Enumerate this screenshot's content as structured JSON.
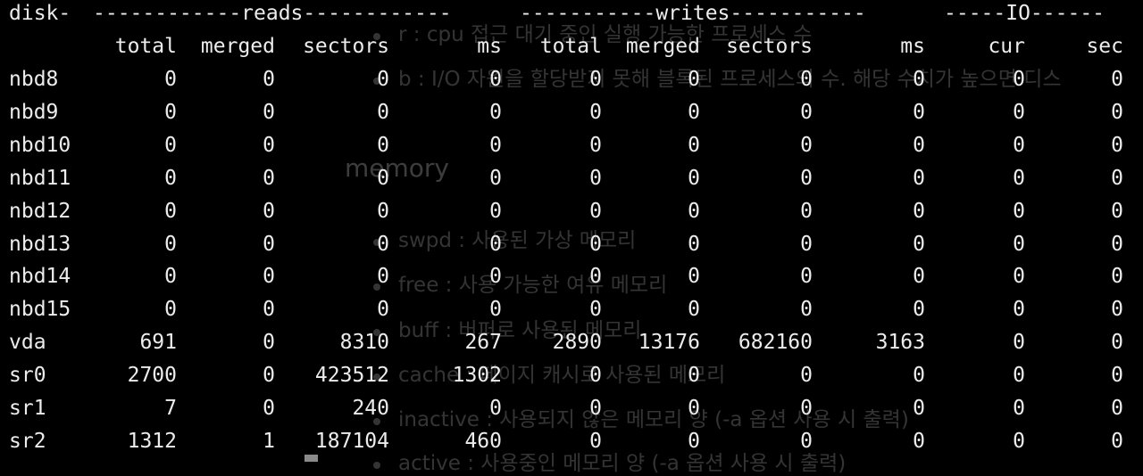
{
  "terminal": {
    "group_header": {
      "disk": "disk-",
      "reads": "------------reads------------",
      "writes": "-----------writes-----------",
      "io": "-----IO------"
    },
    "columns": [
      "total",
      "merged",
      "sectors",
      "ms",
      "total",
      "merged",
      "sectors",
      "ms",
      "cur",
      "sec"
    ],
    "rows": [
      {
        "name": "nbd8",
        "values": [
          "0",
          "0",
          "0",
          "0",
          "0",
          "0",
          "0",
          "0",
          "0",
          "0"
        ]
      },
      {
        "name": "nbd9",
        "values": [
          "0",
          "0",
          "0",
          "0",
          "0",
          "0",
          "0",
          "0",
          "0",
          "0"
        ]
      },
      {
        "name": "nbd10",
        "values": [
          "0",
          "0",
          "0",
          "0",
          "0",
          "0",
          "0",
          "0",
          "0",
          "0"
        ]
      },
      {
        "name": "nbd11",
        "values": [
          "0",
          "0",
          "0",
          "0",
          "0",
          "0",
          "0",
          "0",
          "0",
          "0"
        ]
      },
      {
        "name": "nbd12",
        "values": [
          "0",
          "0",
          "0",
          "0",
          "0",
          "0",
          "0",
          "0",
          "0",
          "0"
        ]
      },
      {
        "name": "nbd13",
        "values": [
          "0",
          "0",
          "0",
          "0",
          "0",
          "0",
          "0",
          "0",
          "0",
          "0"
        ]
      },
      {
        "name": "nbd14",
        "values": [
          "0",
          "0",
          "0",
          "0",
          "0",
          "0",
          "0",
          "0",
          "0",
          "0"
        ]
      },
      {
        "name": "nbd15",
        "values": [
          "0",
          "0",
          "0",
          "0",
          "0",
          "0",
          "0",
          "0",
          "0",
          "0"
        ]
      },
      {
        "name": "vda",
        "values": [
          "691",
          "0",
          "8310",
          "267",
          "2890",
          "13176",
          "682160",
          "3163",
          "0",
          "0"
        ]
      },
      {
        "name": "sr0",
        "values": [
          "2700",
          "0",
          "423512",
          "1302",
          "0",
          "0",
          "0",
          "0",
          "0",
          "0"
        ]
      },
      {
        "name": "sr1",
        "values": [
          "7",
          "0",
          "240",
          "0",
          "0",
          "0",
          "0",
          "0",
          "0",
          "0"
        ]
      },
      {
        "name": "sr2",
        "values": [
          "1312",
          "1",
          "187104",
          "460",
          "0",
          "0",
          "0",
          "0",
          "0",
          "0"
        ]
      }
    ]
  },
  "background_page": {
    "items_top": [
      "r : cpu 접근 대기 중인 실행 가능한 프로세스 수",
      "b : I/O 자원을 할당받지 못해 블록된 프로세스의 수. 해당 수치가 높으면 디스"
    ],
    "heading": "memory",
    "items_memory": [
      "swpd : 사용된 가상 메모리",
      "free : 사용 가능한 여유 메모리",
      "buff : 버퍼로 사용된 메모리",
      "cache : 페이지 캐시로 사용된 메모리",
      "inactive : 사용되지 않은 메모리 양 (-a 옵션 사용 시 출력)",
      "active : 사용중인 메모리 양 (-a 옵션 사용 시 출력)"
    ]
  },
  "colors": {
    "background": "#000000",
    "foreground": "#ececec",
    "cursor": "#8a8a8a"
  }
}
